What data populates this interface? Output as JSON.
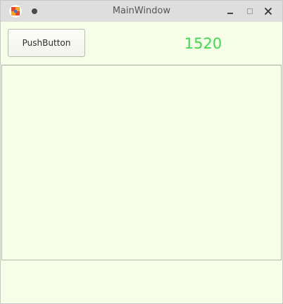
{
  "window": {
    "title": "MainWindow",
    "controls": [
      "minimize-icon",
      "maximize-icon",
      "close-icon"
    ]
  },
  "main": {
    "push_button_label": "PushButton",
    "counter_value": "1520",
    "text_area_value": ""
  },
  "colors": {
    "background": "#f7ffe8",
    "counter": "#3ddc4c",
    "titlebar": "#dedede"
  }
}
